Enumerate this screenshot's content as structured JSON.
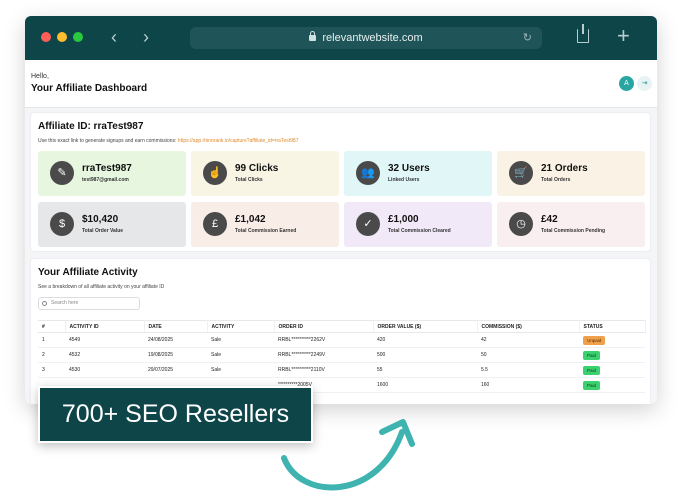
{
  "browser": {
    "url": "relevantwebsite.com",
    "back_icon": "chevron-left-icon",
    "forward_icon": "chevron-right-icon"
  },
  "header": {
    "greeting": "Hello,",
    "title": "Your Affiliate Dashboard",
    "avatar_letter": "A"
  },
  "affiliate": {
    "title": "Affiliate ID: rraTest987",
    "link_text": "Use this exact link to generate signups and earn commissions:",
    "link_url": "https://app.rhinorank.io/capture?affiliate_id=rraTest987"
  },
  "stats": [
    {
      "value": "rraTest987",
      "label": "test987@gmail.com",
      "icon": "pen-icon",
      "bg": "#e6f6df"
    },
    {
      "value": "99 Clicks",
      "label": "Total Clicks",
      "icon": "pointer-click-icon",
      "bg": "#f8f5e4"
    },
    {
      "value": "32 Users",
      "label": "Linked Users",
      "icon": "users-icon",
      "bg": "#e1f6f6"
    },
    {
      "value": "21 Orders",
      "label": "Total Orders",
      "icon": "cart-icon",
      "bg": "#fbf2e6"
    },
    {
      "value": "$10,420",
      "label": "Total Order Value",
      "icon": "dollar-icon",
      "bg": "#e6e7e9"
    },
    {
      "value": "£1,042",
      "label": "Total Commission Earned",
      "icon": "money-bag-icon",
      "bg": "#f9ede8"
    },
    {
      "value": "£1,000",
      "label": "Total Commission Cleared",
      "icon": "clipboard-check-icon",
      "bg": "#f1e9f8"
    },
    {
      "value": "£42",
      "label": "Total Commission Pending",
      "icon": "clock-document-icon",
      "bg": "#f9eef0"
    }
  ],
  "activity": {
    "title": "Your Affiliate Activity",
    "subtitle": "See a breakdown of all affiliate activity on your affiliate ID",
    "search_placeholder": "Search here",
    "columns": [
      "#",
      "ACTIVITY ID",
      "DATE",
      "ACTIVITY",
      "ORDER ID",
      "ORDER VALUE ($)",
      "COMMISSION ($)",
      "STATUS"
    ],
    "rows": [
      {
        "n": "1",
        "activity_id": "4549",
        "date": "24/08/2025",
        "activity": "Sale",
        "order_id": "RRBL**********2262V",
        "order_value": "420",
        "commission": "42",
        "status": "Unpaid"
      },
      {
        "n": "2",
        "activity_id": "4532",
        "date": "19/08/2025",
        "activity": "Sale",
        "order_id": "RRBL**********2249V",
        "order_value": "500",
        "commission": "50",
        "status": "Paid"
      },
      {
        "n": "3",
        "activity_id": "4530",
        "date": "29/07/2025",
        "activity": "Sale",
        "order_id": "RRBL**********2110V",
        "order_value": "55",
        "commission": "5.5",
        "status": "Paid"
      },
      {
        "n": "",
        "activity_id": "",
        "date": "",
        "activity": "",
        "order_id": "**********2005V",
        "order_value": "1600",
        "commission": "160",
        "status": "Paid"
      }
    ]
  },
  "banner": {
    "text": "700+ SEO Resellers"
  },
  "colors": {
    "brand_dark": "#0e4548",
    "accent_orange": "#e08a2c",
    "paid_green": "#3bd16f",
    "unpaid_orange": "#f0a04b"
  }
}
